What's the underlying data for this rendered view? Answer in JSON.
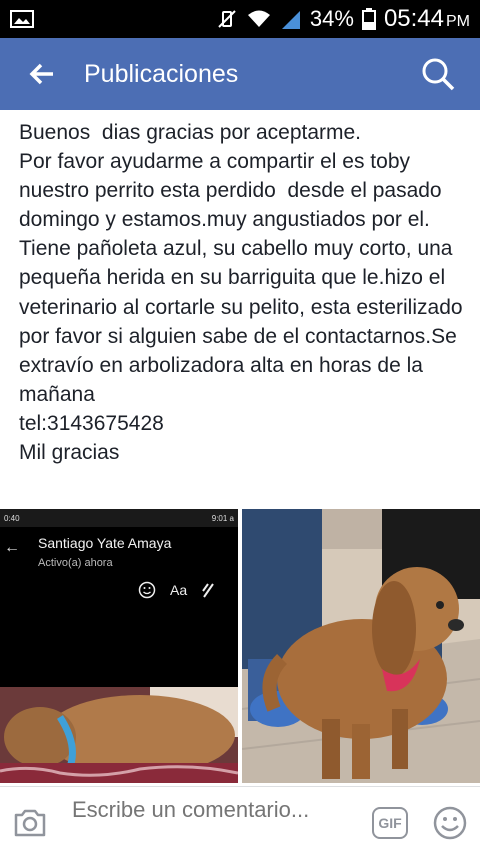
{
  "status_bar": {
    "battery_pct": "34%",
    "time": "05:44",
    "ampm": "PM"
  },
  "app_bar": {
    "title": "Publicaciones"
  },
  "post": {
    "text": "Buenos  dias gracias por aceptarme.\nPor favor ayudarme a compartir el es toby nuestro perrito esta perdido  desde el pasado domingo y estamos.muy angustiados por el.\nTiene pañoleta azul, su cabello muy corto, una pequeña herida en su barriguita que le.hizo el veterinario al cortarle su pelito, esta esterilizado por favor si alguien sabe de el contactarnos.Se extravío en arbolizadora alta en horas de la mañana\ntel:3143675428\nMil gracias"
  },
  "photo_screenshot": {
    "status_time": "9:01 a",
    "status_left": "0:40",
    "contact_name": "Santiago Yate Amaya",
    "contact_status": "Activo(a) ahora",
    "text_size_label": "Aa"
  },
  "comment_bar": {
    "placeholder": "Escribe un comentario...",
    "gif_label": "GIF"
  },
  "colors": {
    "app_bar": "#4c6eb4",
    "text": "#1d2129",
    "muted": "#90949c"
  }
}
